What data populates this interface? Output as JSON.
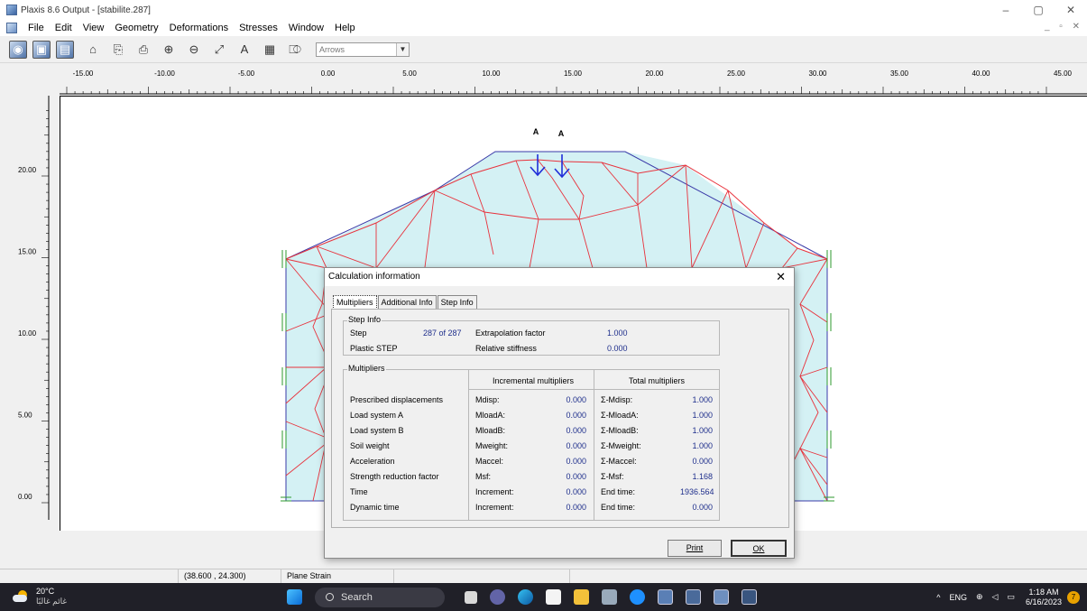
{
  "window": {
    "title": "Plaxis 8.6 Output - [stabilite.287]",
    "controls": [
      "–",
      "▢",
      "✕"
    ],
    "mdi_controls": "_ ▫ ✕"
  },
  "menu": [
    "File",
    "Edit",
    "View",
    "Geometry",
    "Deformations",
    "Stresses",
    "Window",
    "Help"
  ],
  "toolbar": {
    "display_mode": "Arrows"
  },
  "ruler": {
    "x_ticks": [
      "-15.00",
      "-10.00",
      "-5.00",
      "0.00",
      "5.00",
      "10.00",
      "15.00",
      "20.00",
      "25.00",
      "30.00",
      "35.00",
      "40.00",
      "45.00"
    ],
    "y_ticks": [
      "20.00",
      "15.00",
      "10.00",
      "5.00",
      "0.00"
    ]
  },
  "model": {
    "load_labels": [
      "A",
      "A"
    ],
    "colors": {
      "fill": "#d4f1f4",
      "mesh": "#e8323c",
      "boundary": "#3a3aa8",
      "load": "#1f2ed8",
      "fixity": "#2e9a2e"
    }
  },
  "status": {
    "coords": "(38.600 , 24.300)",
    "mode": "Plane Strain"
  },
  "dialog": {
    "title": "Calculation information",
    "close": "✕",
    "tabs": [
      "Multipliers",
      "Additional Info",
      "Step Info"
    ],
    "step_info": {
      "group": "Step Info",
      "step_label": "Step",
      "step_value": "287 of 287",
      "plastic_label": "Plastic STEP",
      "extrapolation_label": "Extrapolation factor",
      "extrapolation_value": "1.000",
      "stiffness_label": "Relative stiffness",
      "stiffness_value": "0.000"
    },
    "multipliers": {
      "group": "Multipliers",
      "incremental_header": "Incremental multipliers",
      "total_header": "Total multipliers",
      "rows": [
        {
          "name": "Prescribed displacements",
          "inc_label": "Mdisp:",
          "inc_value": "0.000",
          "tot_label": "Σ-Mdisp:",
          "tot_value": "1.000"
        },
        {
          "name": "Load system A",
          "inc_label": "MloadA:",
          "inc_value": "0.000",
          "tot_label": "Σ-MloadA:",
          "tot_value": "1.000"
        },
        {
          "name": "Load system B",
          "inc_label": "MloadB:",
          "inc_value": "0.000",
          "tot_label": "Σ-MloadB:",
          "tot_value": "1.000"
        },
        {
          "name": "Soil weight",
          "inc_label": "Mweight:",
          "inc_value": "0.000",
          "tot_label": "Σ-Mweight:",
          "tot_value": "1.000"
        },
        {
          "name": "Acceleration",
          "inc_label": "Maccel:",
          "inc_value": "0.000",
          "tot_label": "Σ-Maccel:",
          "tot_value": "0.000"
        },
        {
          "name": "Strength reduction factor",
          "inc_label": "Msf:",
          "inc_value": "0.000",
          "tot_label": "Σ-Msf:",
          "tot_value": "1.168"
        },
        {
          "name": "Time",
          "inc_label": "Increment:",
          "inc_value": "0.000",
          "tot_label": "End time:",
          "tot_value": "1936.564"
        },
        {
          "name": "Dynamic time",
          "inc_label": "Increment:",
          "inc_value": "0.000",
          "tot_label": "End time:",
          "tot_value": "0.000"
        }
      ]
    },
    "print_button": "Print",
    "ok_button": "OK"
  },
  "taskbar": {
    "temperature": "20°C",
    "weather": "غائم غالبًا",
    "search": "Search",
    "tray_arrow": "^",
    "language": "ENG",
    "time": "1:18 AM",
    "date": "6/16/2023",
    "notifications": "7"
  }
}
